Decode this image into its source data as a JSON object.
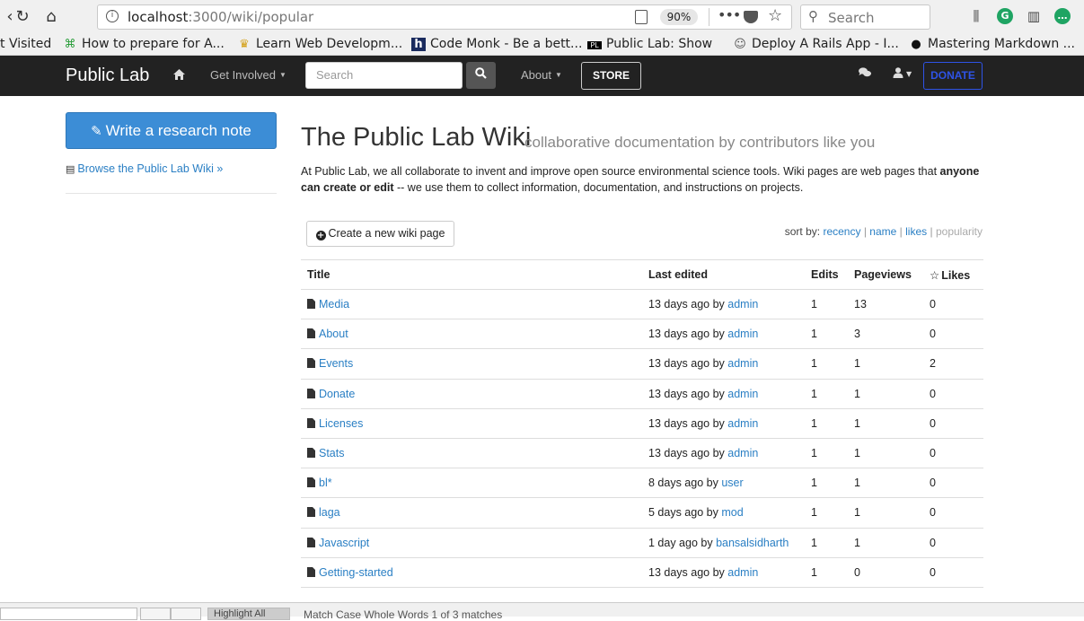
{
  "browser": {
    "url_host": "localhost",
    "url_path": ":3000/wiki/popular",
    "zoom": "90%",
    "search_placeholder": "Search"
  },
  "bookmarks": [
    {
      "icon": "",
      "label": "t Visited"
    },
    {
      "icon": "⌘",
      "label": "How to prepare for A..."
    },
    {
      "icon": "♛",
      "label": "Learn Web Developm..."
    },
    {
      "icon": "h",
      "label": "Code Monk - Be a bett..."
    },
    {
      "icon": "PL",
      "label": "Public Lab: Show"
    },
    {
      "icon": "☺",
      "label": "Deploy A Rails App - I..."
    },
    {
      "icon": "●",
      "label": "Mastering Markdown ..."
    }
  ],
  "navbar": {
    "brand": "Public Lab",
    "get_involved": "Get Involved",
    "search_placeholder": "Search",
    "about": "About",
    "store": "STORE",
    "donate": "DONATE"
  },
  "sidebar": {
    "write_button": "Write a research note",
    "browse_link": "Browse the Public Lab Wiki »"
  },
  "main": {
    "title": "The Public Lab Wiki",
    "subtitle": "collaborative documentation by contributors like you",
    "intro_1": "At Public Lab, we all collaborate to invent and improve open source environmental science tools. Wiki pages are web pages that ",
    "intro_bold": "anyone can create or edit",
    "intro_2": " -- we use them to collect information, documentation, and instructions on projects.",
    "create_button": "Create a new wiki page",
    "sort_label": "sort by:",
    "sort_options": [
      "recency",
      "name",
      "likes",
      "popularity"
    ]
  },
  "table": {
    "headers": [
      "Title",
      "Last edited",
      "Edits",
      "Pageviews",
      "Likes"
    ],
    "rows": [
      {
        "title": "Media",
        "edited": "13 days ago by",
        "author": "admin",
        "edits": "1",
        "views": "13",
        "likes": "0"
      },
      {
        "title": "About",
        "edited": "13 days ago by",
        "author": "admin",
        "edits": "1",
        "views": "3",
        "likes": "0"
      },
      {
        "title": "Events",
        "edited": "13 days ago by",
        "author": "admin",
        "edits": "1",
        "views": "1",
        "likes": "2"
      },
      {
        "title": "Donate",
        "edited": "13 days ago by",
        "author": "admin",
        "edits": "1",
        "views": "1",
        "likes": "0"
      },
      {
        "title": "Licenses",
        "edited": "13 days ago by",
        "author": "admin",
        "edits": "1",
        "views": "1",
        "likes": "0"
      },
      {
        "title": "Stats",
        "edited": "13 days ago by",
        "author": "admin",
        "edits": "1",
        "views": "1",
        "likes": "0"
      },
      {
        "title": "bl*",
        "edited": "8 days ago by",
        "author": "user",
        "edits": "1",
        "views": "1",
        "likes": "0"
      },
      {
        "title": "laga",
        "edited": "5 days ago by",
        "author": "mod",
        "edits": "1",
        "views": "1",
        "likes": "0"
      },
      {
        "title": "Javascript",
        "edited": "1 day ago by",
        "author": "bansalsidharth",
        "edits": "1",
        "views": "1",
        "likes": "0"
      },
      {
        "title": "Getting-started",
        "edited": "13 days ago by",
        "author": "admin",
        "edits": "1",
        "views": "0",
        "likes": "0"
      }
    ]
  },
  "findbar": {
    "highlight": "Highlight All",
    "text": "Match Case   Whole Words   1 of 3 matches"
  },
  "colors": {
    "navbar_bg": "#222222",
    "link": "#2a7fc4",
    "primary_button": "#3c8dd6",
    "donate": "#2e53e6"
  }
}
